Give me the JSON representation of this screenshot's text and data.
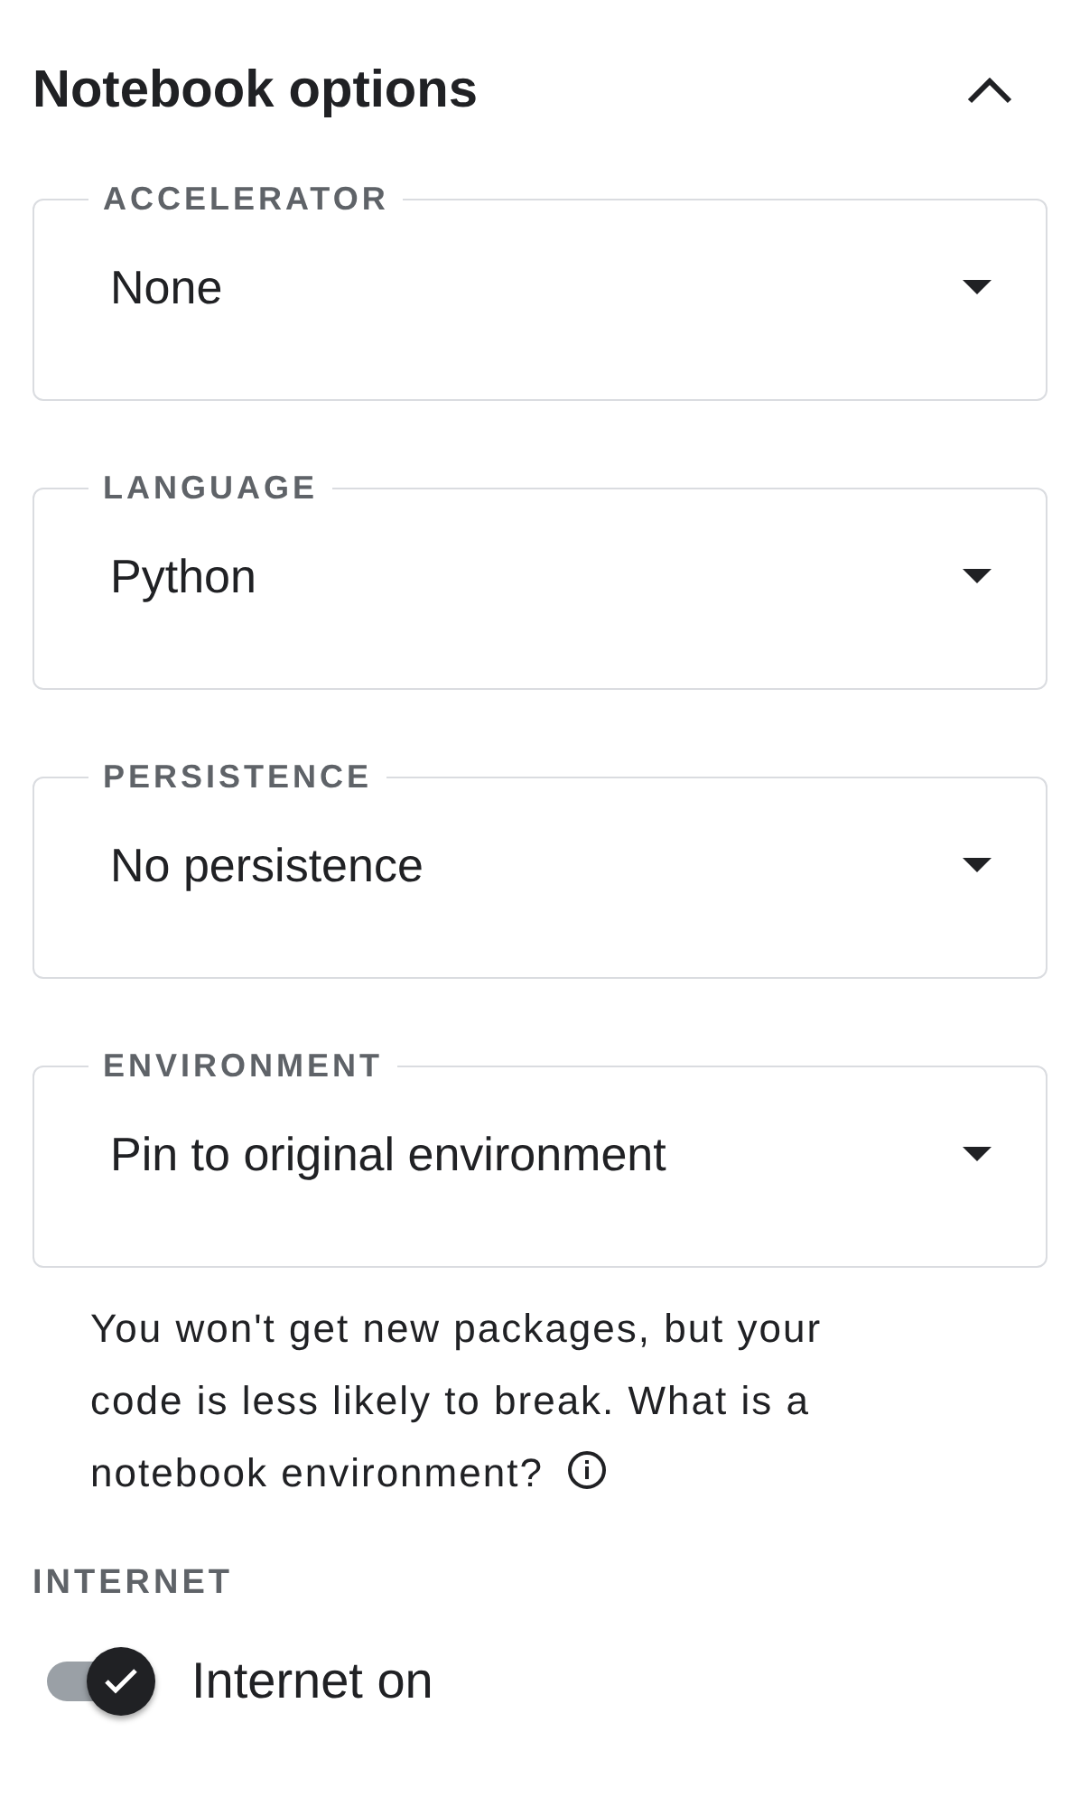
{
  "panel": {
    "title": "Notebook options",
    "expanded": true
  },
  "fields": [
    {
      "label": "ACCELERATOR",
      "value": "None"
    },
    {
      "label": "LANGUAGE",
      "value": "Python"
    },
    {
      "label": "PERSISTENCE",
      "value": "No persistence"
    },
    {
      "label": "ENVIRONMENT",
      "value": "Pin to original environment"
    }
  ],
  "environment_help": "You won't get new packages, but your code is less likely to break. What is a notebook environment?",
  "internet": {
    "heading": "INTERNET",
    "label": "Internet on",
    "checked": true
  }
}
